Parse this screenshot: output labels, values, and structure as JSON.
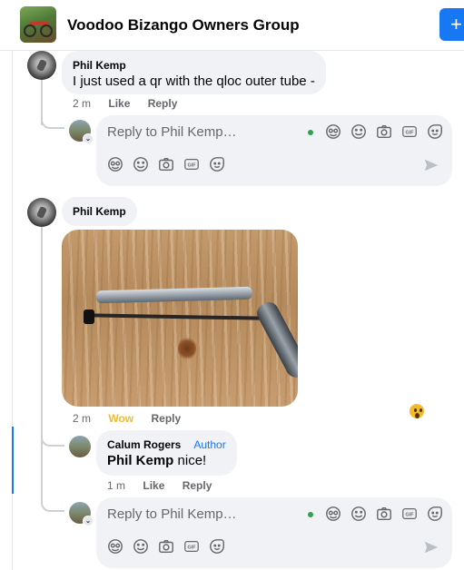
{
  "header": {
    "group_name": "Voodoo Bizango Owners Group",
    "action_icon": "plus-icon"
  },
  "comments": [
    {
      "author": "Phil Kemp",
      "text": "I just used a qr with the qloc outer tube -",
      "time": "2 m",
      "like_label": "Like",
      "reply_label": "Reply"
    },
    {
      "author": "Phil Kemp",
      "attachment": "photo of quick-release skewer and outer tube on wooden surface",
      "time": "2 m",
      "reaction_label": "Wow",
      "reply_label": "Reply",
      "reaction_icon": "wow-emoji-icon"
    }
  ],
  "reply": {
    "author": "Calum Rogers",
    "badge": "Author",
    "mention": "Phil Kemp",
    "text": " nice!",
    "time": "1 m",
    "like_label": "Like",
    "reply_label": "Reply"
  },
  "composer": {
    "placeholder": "Reply to Phil Kemp…",
    "icons": [
      "avatar-sticker-icon",
      "emoji-icon",
      "camera-icon",
      "gif-icon",
      "sticker-icon",
      "send-icon"
    ]
  },
  "colors": {
    "accent": "#1877f2",
    "bubble": "#f0f2f5",
    "online": "#31a24c",
    "wow": "#f7b928"
  }
}
